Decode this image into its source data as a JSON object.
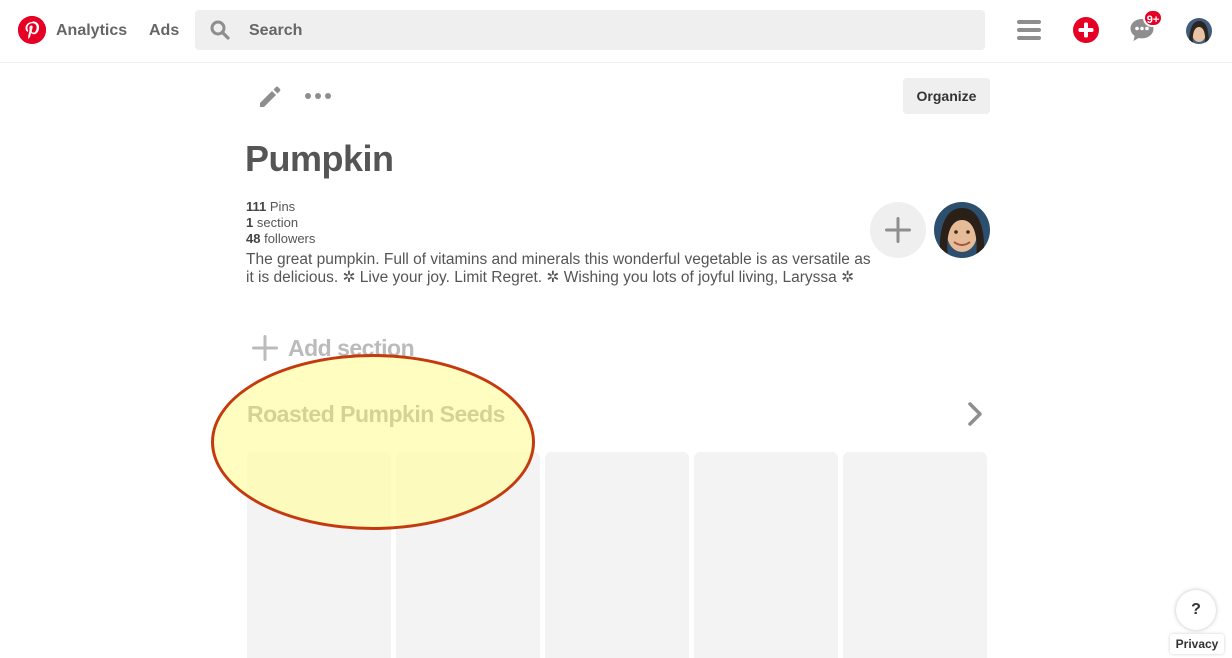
{
  "header": {
    "analytics_label": "Analytics",
    "ads_label": "Ads",
    "search": {
      "placeholder": "Search"
    },
    "notification_badge": "9+",
    "brand_color": "#e60023"
  },
  "board": {
    "organize_label": "Organize",
    "title": "Pumpkin",
    "stats": {
      "pins_count": "111",
      "pins_label": "Pins",
      "sections_count": "1",
      "sections_label": "section",
      "followers_count": "48",
      "followers_label": "followers"
    },
    "description": "The great pumpkin. Full of vitamins and minerals this wonderful vegetable is as versatile as it is delicious. ✲ Live your joy. Limit Regret. ✲ Wishing you lots of joyful living, Laryssa ✲",
    "add_section_label": "Add section"
  },
  "section": {
    "title": "Roasted Pumpkin Seeds",
    "highlight_color": "#c43a0e"
  },
  "footer": {
    "help_label": "?",
    "privacy_label": "Privacy"
  },
  "icons": [
    "pinterest-logo-icon",
    "search-icon",
    "menu-icon",
    "plus-icon",
    "messages-icon",
    "pencil-icon",
    "more-icon",
    "chevron-right-icon"
  ]
}
